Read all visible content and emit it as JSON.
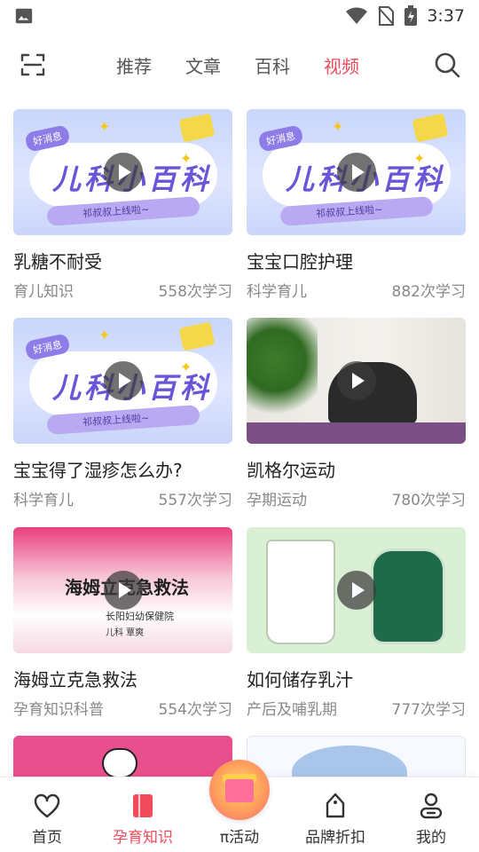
{
  "status_bar": {
    "time": "3:37",
    "icons": [
      "image-icon",
      "wifi-icon",
      "no-sim-icon",
      "battery-charging-icon"
    ]
  },
  "top_nav": {
    "scan_icon": "scan-icon",
    "search_icon": "search-icon",
    "tabs": [
      {
        "label": "推荐",
        "active": false
      },
      {
        "label": "文章",
        "active": false
      },
      {
        "label": "百科",
        "active": false
      },
      {
        "label": "视频",
        "active": true
      }
    ],
    "accent_color": "#ef4b5a"
  },
  "videos": [
    {
      "title": "乳糖不耐受",
      "category": "育儿知识",
      "views": "558次学习",
      "thumb": {
        "bubble": "好消息",
        "big": "儿科小百科",
        "ribbon": "祁叔叔上线啦~"
      }
    },
    {
      "title": "宝宝口腔护理",
      "category": "科学育儿",
      "views": "882次学习",
      "thumb": {
        "bubble": "好消息",
        "big": "儿科小百科",
        "ribbon": "祁叔叔上线啦~"
      }
    },
    {
      "title": "宝宝得了湿疹怎么办?",
      "category": "科学育儿",
      "views": "557次学习",
      "thumb": {
        "bubble": "好消息",
        "big": "儿科小百科",
        "ribbon": "祁叔叔上线啦~"
      }
    },
    {
      "title": "凯格尔运动",
      "category": "孕期运动",
      "views": "780次学习"
    },
    {
      "title": "海姆立克急救法",
      "category": "孕育知识科普",
      "views": "554次学习",
      "thumb": {
        "title": "海姆立克急救法",
        "org": "长阳妇幼保健院",
        "doctor": "儿科 覃爽"
      }
    },
    {
      "title": "如何储存乳汁",
      "category": "产后及哺乳期",
      "views": "777次学习"
    }
  ],
  "bottom_nav": {
    "items": [
      {
        "label": "首页",
        "icon": "heart-icon",
        "active": false
      },
      {
        "label": "孕育知识",
        "icon": "book-icon",
        "active": true
      },
      {
        "label": "π活动",
        "icon": "gift-icon",
        "active": false
      },
      {
        "label": "品牌折扣",
        "icon": "tag-icon",
        "active": false
      },
      {
        "label": "我的",
        "icon": "user-icon",
        "active": false
      }
    ]
  }
}
